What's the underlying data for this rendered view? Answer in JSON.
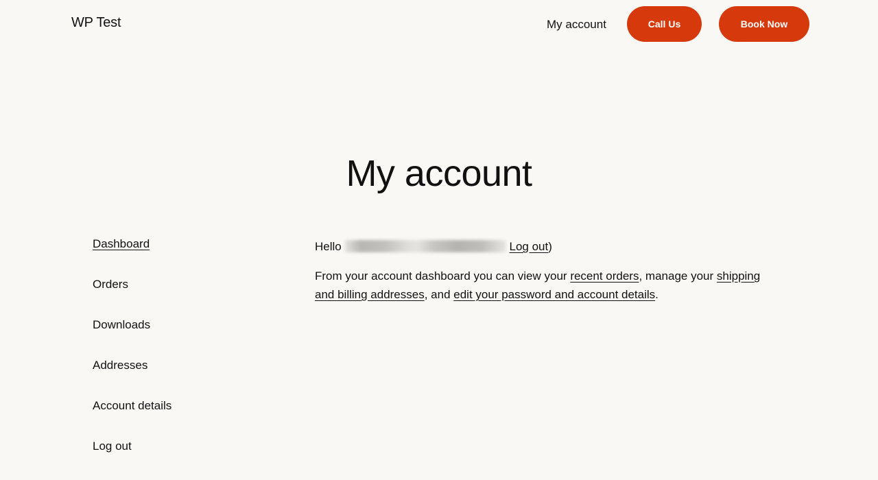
{
  "header": {
    "site_title": "WP Test",
    "nav_link": "My account",
    "call_button": "Call Us",
    "book_button": "Book Now",
    "accent_color": "#d63a0c"
  },
  "page": {
    "title": "My account"
  },
  "account_nav": {
    "items": [
      {
        "label": "Dashboard",
        "active": true
      },
      {
        "label": "Orders",
        "active": false
      },
      {
        "label": "Downloads",
        "active": false
      },
      {
        "label": "Addresses",
        "active": false
      },
      {
        "label": "Account details",
        "active": false
      },
      {
        "label": "Log out",
        "active": false
      }
    ]
  },
  "dashboard": {
    "hello_prefix": "Hello",
    "username_redacted": true,
    "logout_link": "Log out",
    "logout_suffix": ")",
    "intro_prefix": "From your account dashboard you can view your ",
    "recent_orders_link": "recent orders",
    "intro_mid1": ", manage your ",
    "addresses_link": "shipping and billing addresses",
    "intro_mid2": ", and ",
    "account_details_link": "edit your password and account details",
    "intro_suffix": "."
  }
}
